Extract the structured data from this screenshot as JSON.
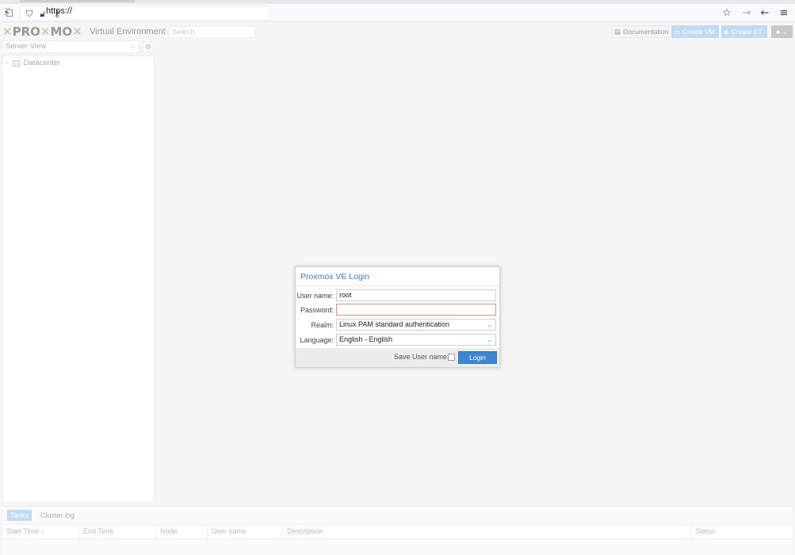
{
  "browser": {
    "url": "https://",
    "icons": {
      "sidebar": "sidebar-toggle-icon",
      "shield": "tracking-shield-icon",
      "lock": "insecure-lock-icon",
      "key": "key-icon",
      "star": "bookmark-star-icon",
      "forward": "forward-arrow-icon",
      "back": "back-arrow-icon",
      "menu": "hamburger-menu-icon"
    }
  },
  "header": {
    "logo_a": "PRO",
    "logo_b": "MO",
    "subtitle": "Virtual Environment",
    "search_placeholder": "Search",
    "documentation": "Documentation",
    "create_vm": "Create VM",
    "create_ct": "Create CT"
  },
  "sidebar": {
    "view_select": "Server View",
    "tree": [
      {
        "label": "Datacenter"
      }
    ]
  },
  "bottom": {
    "tabs": [
      "Tasks",
      "Cluster log"
    ],
    "columns": [
      "Start Time",
      "End Time",
      "Node",
      "User name",
      "Description",
      "Status"
    ]
  },
  "login": {
    "title": "Proxmox VE Login",
    "username_label": "User name:",
    "username_value": "root",
    "password_label": "Password:",
    "password_value": "",
    "realm_label": "Realm:",
    "realm_value": "Linux PAM standard authentication",
    "language_label": "Language:",
    "language_value": "English - English",
    "save_user_label": "Save User name:",
    "save_user_checked": false,
    "login_button": "Login"
  },
  "colors": {
    "accent": "#3c87cf",
    "title_blue": "#3b7bbf",
    "disabled_blue": "#c2dbf2",
    "error_border": "#d9967a"
  }
}
